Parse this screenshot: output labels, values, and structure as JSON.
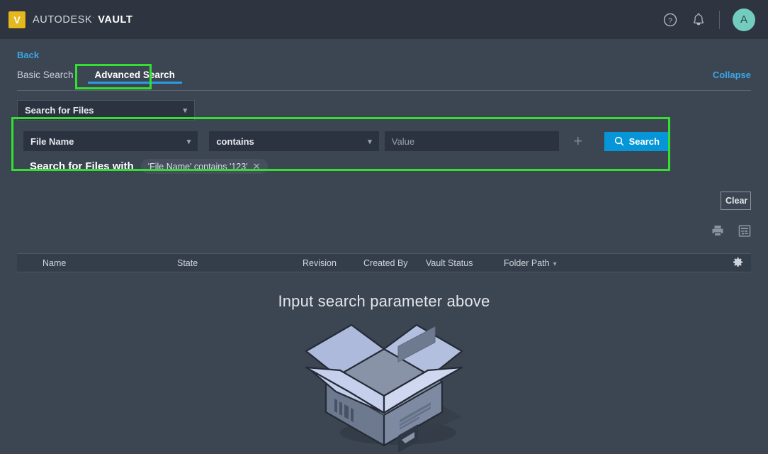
{
  "app": {
    "brand_prefix": "AUTODESK",
    "brand_trademark": "·",
    "brand_product": "VAULT",
    "logo_letter": "V"
  },
  "header": {
    "help_icon": "question-circle-icon",
    "notifications_icon": "bell-icon",
    "avatar_letter": "A"
  },
  "nav": {
    "back_label": "Back",
    "collapse_label": "Collapse",
    "tabs": [
      {
        "label": "Basic Search",
        "active": false
      },
      {
        "label": "Advanced Search",
        "active": true
      }
    ]
  },
  "search": {
    "scope_value": "Search for Files",
    "criteria_row": {
      "attribute_value": "File Name",
      "condition_value": "contains",
      "value_placeholder": "Value",
      "value_current": "",
      "add_label": "+",
      "search_button_label": "Search",
      "search_icon": "magnifier-icon"
    },
    "summary_label": "Search for Files with",
    "chips": [
      {
        "text": "'File Name' contains '123'",
        "close": "✕"
      }
    ],
    "clear_label": "Clear"
  },
  "toolbar": {
    "print_icon": "printer-icon",
    "view_options_icon": "list-settings-icon"
  },
  "results": {
    "columns": [
      {
        "label": "Name",
        "sortable": true,
        "has_menu": false
      },
      {
        "label": "State",
        "sortable": true,
        "has_menu": false
      },
      {
        "label": "Revision",
        "sortable": true,
        "has_menu": false
      },
      {
        "label": "Created By",
        "sortable": true,
        "has_menu": false
      },
      {
        "label": "Vault Status",
        "sortable": true,
        "has_menu": false
      },
      {
        "label": "Folder Path",
        "sortable": true,
        "has_menu": true
      }
    ],
    "settings_icon": "gear-icon",
    "empty_message": "Input search parameter above",
    "empty_illustration": "open-empty-box"
  },
  "colors": {
    "topbar_bg": "#2e3440",
    "page_bg": "#3c4552",
    "accent_blue": "#0696d7",
    "link_blue": "#3aa7e8",
    "highlight_green": "#33e032",
    "avatar_teal": "#72cdbf",
    "logo_yellow": "#e5b91e",
    "field_bg": "#2c3340"
  }
}
